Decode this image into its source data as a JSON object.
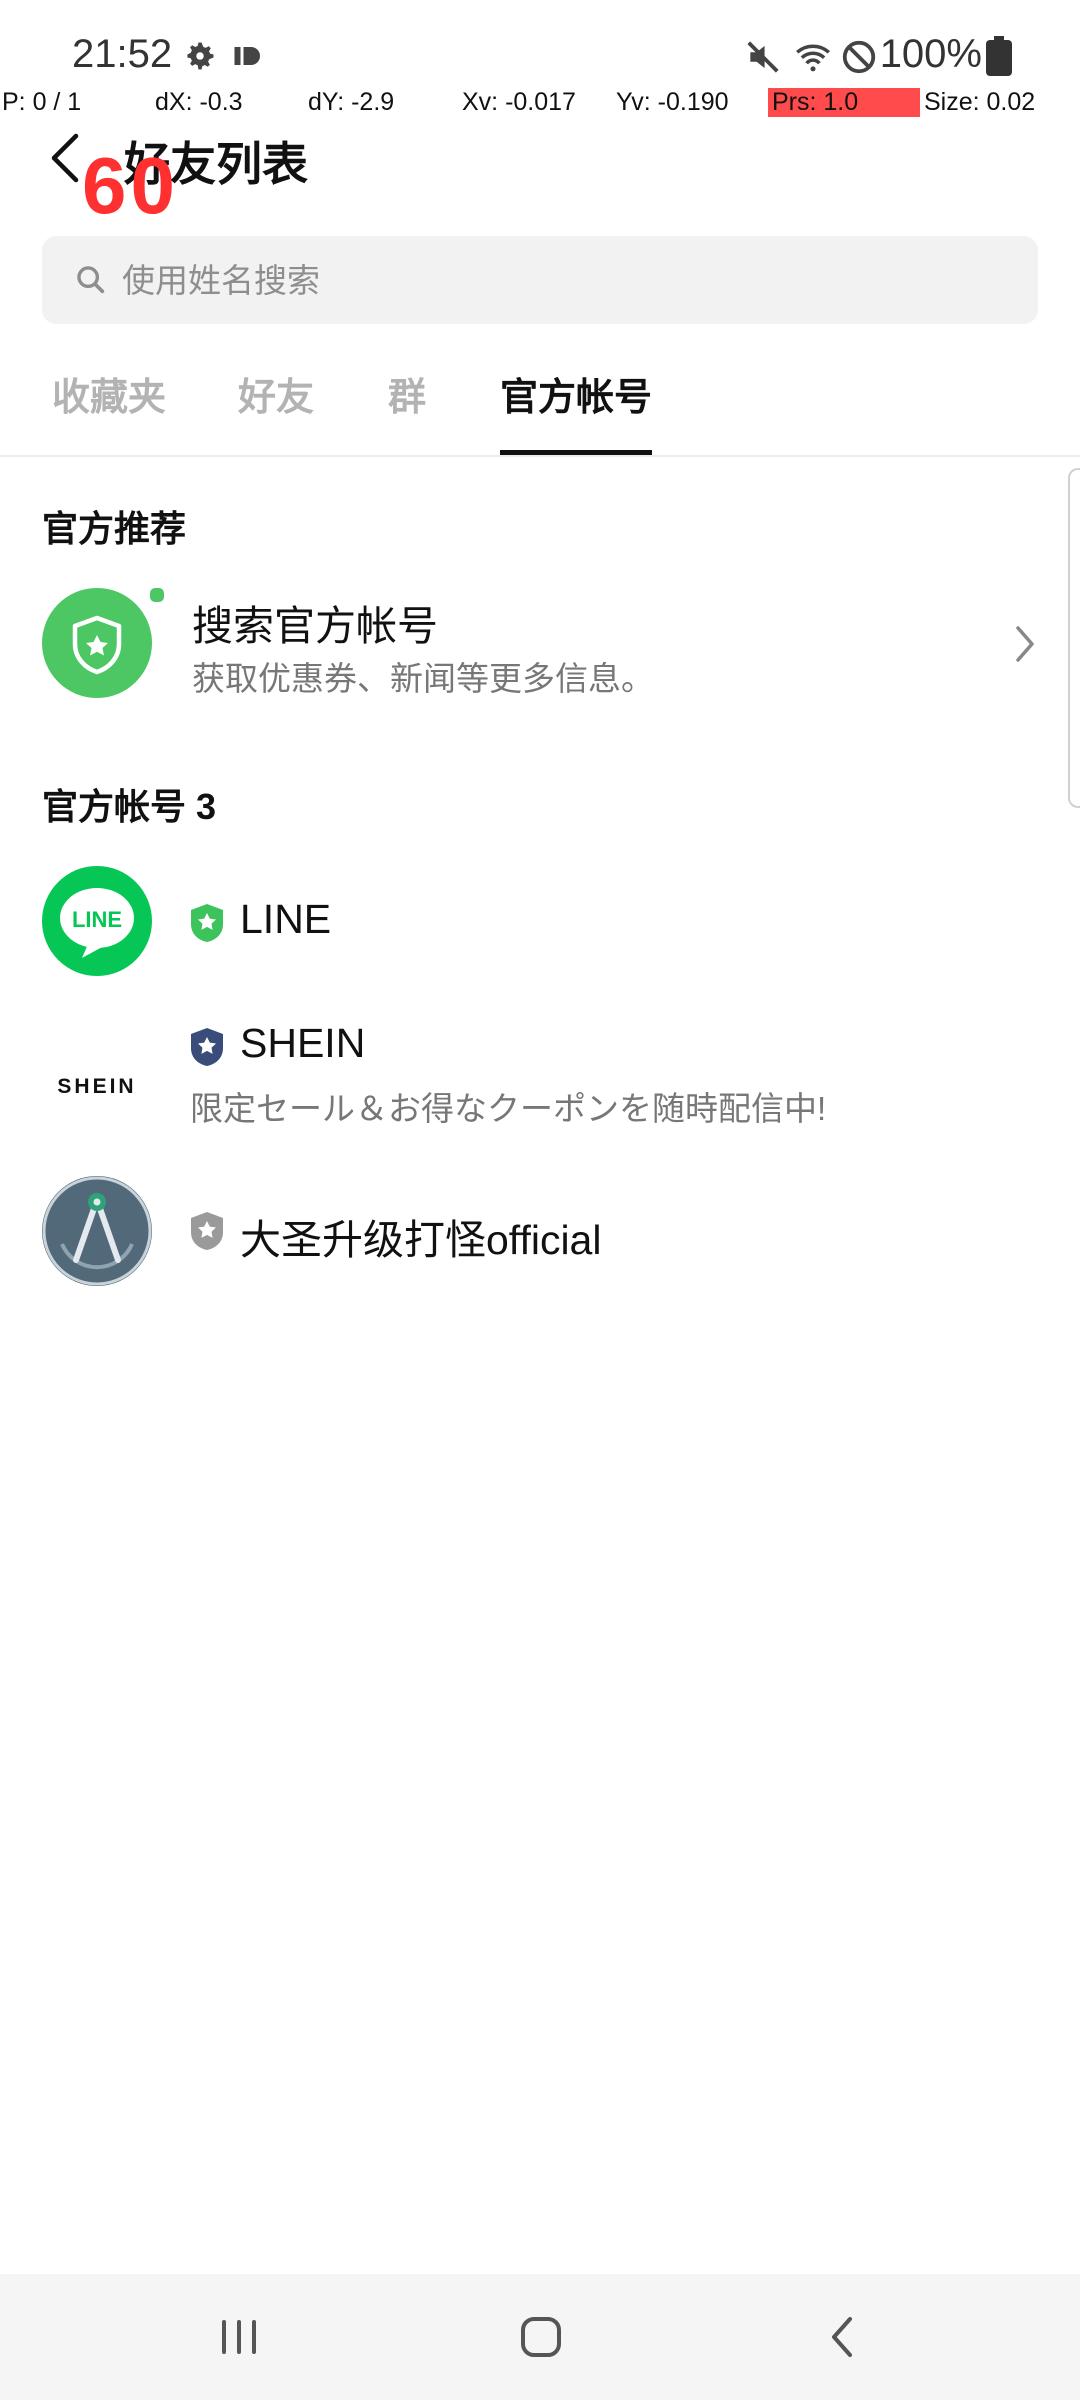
{
  "status_bar": {
    "time": "21:52",
    "battery": "100%",
    "icons": [
      "settings-icon",
      "id-icon",
      "mute-icon",
      "wifi-icon",
      "dnd-icon",
      "battery-icon"
    ]
  },
  "debug_overlay": {
    "p": "P: 0 / 1",
    "dx": "dX: -0.3",
    "dy": "dY: -2.9",
    "xv": "Xv: -0.017",
    "yv": "Yv: -0.190",
    "prs": "Prs: 1.0",
    "size": "Size: 0.02",
    "fps": "60"
  },
  "header": {
    "title": "好友列表"
  },
  "search": {
    "placeholder": "使用姓名搜索",
    "value": ""
  },
  "tabs": [
    {
      "label": "收藏夹",
      "active": false
    },
    {
      "label": "好友",
      "active": false
    },
    {
      "label": "群",
      "active": false
    },
    {
      "label": "官方帐号",
      "active": true
    }
  ],
  "recommend": {
    "section_title": "官方推荐",
    "item": {
      "name": "搜索官方帐号",
      "subtitle": "获取优惠券、新闻等更多信息。"
    }
  },
  "accounts": {
    "section_title": "官方帐号 3",
    "items": [
      {
        "name": "LINE",
        "subtitle": "",
        "badge_color": "#3cc35b",
        "logo_text": "LINE"
      },
      {
        "name": "SHEIN",
        "subtitle": "限定セール＆お得なクーポンを随時配信中!",
        "badge_color": "#3a4d7a",
        "logo_text": "SHEIN"
      },
      {
        "name": "大圣升级打怪official",
        "subtitle": "",
        "badge_color": "#9a9a9a",
        "logo_text": ""
      }
    ]
  },
  "colors": {
    "accent_green": "#4cc764",
    "line_green": "#06c755",
    "active_tab": "#111111",
    "inactive_tab": "#b3b3b3"
  }
}
